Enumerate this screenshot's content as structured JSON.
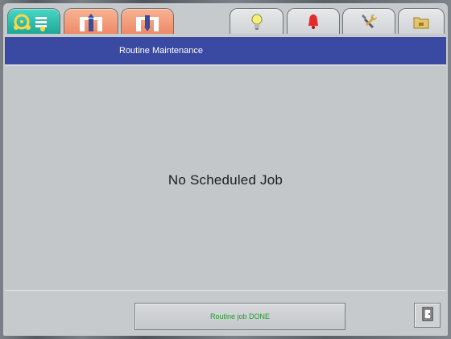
{
  "tabs": {
    "items": [
      {
        "icon": "gauge-panel-icon",
        "color": "#2fbfae",
        "active": true
      },
      {
        "icon": "operator-upload-icon",
        "color": "#f19d7b"
      },
      {
        "icon": "operator-download-icon",
        "color": "#f19d7b"
      },
      {
        "icon": "lightbulb-icon",
        "color": "#e7e9eb"
      },
      {
        "icon": "alarm-bell-icon",
        "color": "#e7e9eb"
      },
      {
        "icon": "tools-icon",
        "color": "#e7e9eb"
      },
      {
        "icon": "folder-icon",
        "color": "#e7e9eb"
      }
    ]
  },
  "header": {
    "title": "Routine Maintenance",
    "background": "#3a49a1"
  },
  "main": {
    "message": "No Scheduled Job"
  },
  "footer": {
    "done_label": "Routine job DONE",
    "done_text_color": "#1f9a2a",
    "exit_icon": "door-exit-icon"
  }
}
